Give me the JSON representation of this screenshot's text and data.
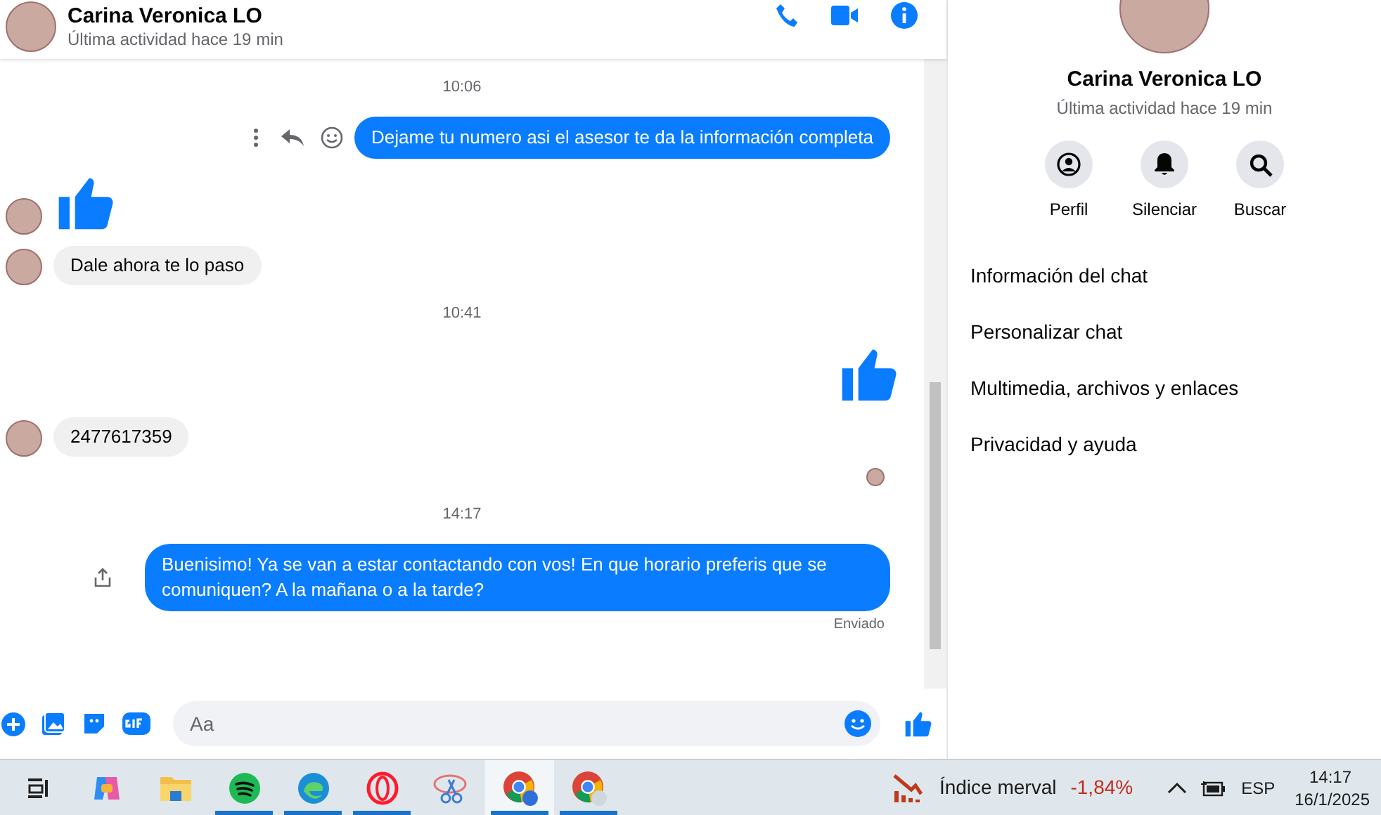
{
  "chat_header": {
    "name": "Carina Veronica LO",
    "status": "Última actividad hace 19 min"
  },
  "messages": [
    {
      "kind": "time",
      "text": "10:06"
    },
    {
      "kind": "text",
      "outgoing": true,
      "text": "Dejame tu numero asi el asesor te da la información completa",
      "actions": true
    },
    {
      "kind": "like",
      "outgoing": false
    },
    {
      "kind": "text",
      "outgoing": false,
      "text": "Dale ahora te lo paso"
    },
    {
      "kind": "time",
      "text": "10:41"
    },
    {
      "kind": "like",
      "outgoing": true
    },
    {
      "kind": "text",
      "outgoing": false,
      "text": "2477617359"
    },
    {
      "kind": "seen"
    },
    {
      "kind": "time",
      "text": "14:17"
    },
    {
      "kind": "text",
      "outgoing": true,
      "text": "Buenisimo! Ya se van a estar contactando con vos! En que horario preferis que se comuniquen? A la mañana o a la tarde?",
      "share": true
    },
    {
      "kind": "status",
      "text": "Enviado"
    }
  ],
  "composer": {
    "placeholder": "Aa"
  },
  "profile_panel": {
    "name": "Carina Veronica LO",
    "status": "Última actividad hace 19 min",
    "actions": [
      {
        "kind": "profile",
        "label": "Perfil"
      },
      {
        "kind": "mute",
        "label": "Silenciar"
      },
      {
        "kind": "search",
        "label": "Buscar"
      }
    ],
    "sections": [
      "Información del chat",
      "Personalizar chat",
      "Multimedia, archivos y enlaces",
      "Privacidad y ayuda"
    ]
  },
  "taskbar": {
    "apps": [
      {
        "kind": "taskview",
        "open": false,
        "selected": false
      },
      {
        "kind": "copilot",
        "open": false,
        "selected": false
      },
      {
        "kind": "folder",
        "open": false,
        "selected": false
      },
      {
        "kind": "spotify",
        "open": true,
        "selected": false
      },
      {
        "kind": "edge",
        "open": true,
        "selected": false
      },
      {
        "kind": "opera",
        "open": true,
        "selected": false
      },
      {
        "kind": "snip",
        "open": false,
        "selected": false
      },
      {
        "kind": "chrome",
        "open": true,
        "selected": true
      },
      {
        "kind": "chrome-profile",
        "open": true,
        "selected": false
      }
    ],
    "widget": {
      "label": "Índice merval",
      "value": "-1,84%"
    },
    "language": "ESP",
    "time": "14:17",
    "date": "16/1/2025"
  }
}
